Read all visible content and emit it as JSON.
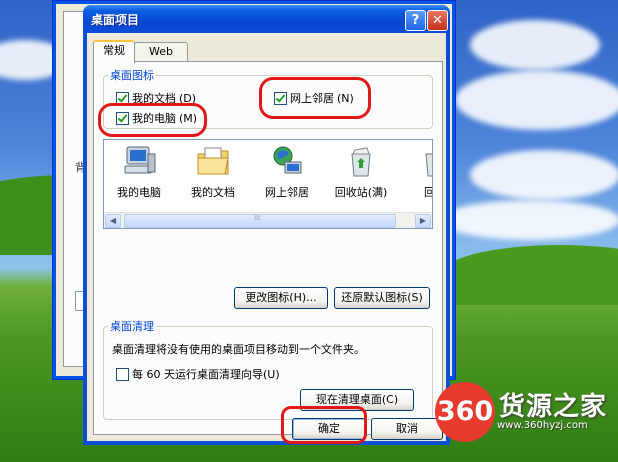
{
  "dialog": {
    "title": "桌面项目",
    "help_glyph": "?",
    "close_glyph": "✕",
    "tabs": [
      {
        "label": "常规",
        "active": true
      },
      {
        "label": "Web",
        "active": false
      }
    ]
  },
  "desktop_icons_group": {
    "legend": "桌面图标",
    "checkboxes": [
      {
        "label": "我的文档",
        "mnemonic": "(D)",
        "checked": true
      },
      {
        "label": "我的电脑",
        "mnemonic": "(M)",
        "checked": true
      },
      {
        "label": "网上邻居",
        "mnemonic": "(N)",
        "checked": true
      }
    ]
  },
  "icon_list": {
    "items": [
      {
        "label": "我的电脑",
        "icon": "my-computer-icon"
      },
      {
        "label": "我的文档",
        "icon": "my-documents-icon"
      },
      {
        "label": "网上邻居",
        "icon": "network-places-icon"
      },
      {
        "label": "回收站(满)",
        "icon": "recycle-bin-full-icon"
      },
      {
        "label": "回收",
        "icon": "recycle-bin-icon"
      }
    ],
    "scroll_left": "◀",
    "scroll_right": "▶"
  },
  "buttons": {
    "change_icon": "更改图标(H)...",
    "restore_default": "还原默认图标(S)",
    "clean_now": "现在清理桌面(C)",
    "ok": "确定",
    "cancel": "取消"
  },
  "cleanup_group": {
    "legend": "桌面清理",
    "description": "桌面清理将没有使用的桌面项目移动到一个文件夹。",
    "checkbox": {
      "label": "每 60 天运行桌面清理向导(U)",
      "checked": false
    }
  },
  "background_window": {
    "label": "背"
  },
  "watermark": {
    "badge": "360",
    "name": "货源之家",
    "url": "www.360hyzj.com"
  },
  "colors": {
    "highlight": "#e01818",
    "title_bar": "#0a5ee0",
    "legend": "#0046d5"
  }
}
